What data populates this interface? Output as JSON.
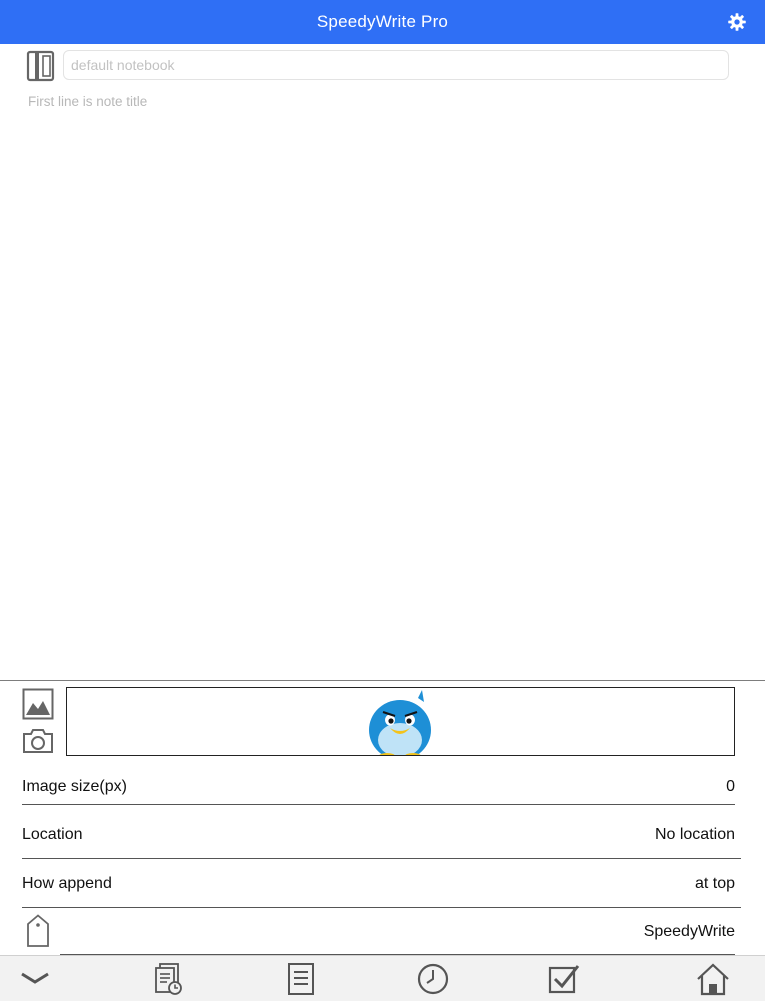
{
  "app": {
    "title": "SpeedyWrite Pro",
    "accent_color": "#2f6ff5"
  },
  "header": {
    "settings_icon": "gear-icon"
  },
  "notebook": {
    "icon": "notebook-icon",
    "placeholder": "default notebook",
    "value": ""
  },
  "note": {
    "placeholder": "First line is note title",
    "value": ""
  },
  "attachments": {
    "image_picker_icon": "image-icon",
    "camera_icon": "camera-icon",
    "preview": "penguin mascot"
  },
  "settings_rows": [
    {
      "label": "Image size(px)",
      "value": "0"
    },
    {
      "label": "Location",
      "value": "No location"
    },
    {
      "label": "How append",
      "value": "at top"
    },
    {
      "label": "",
      "value": "SpeedyWrite",
      "icon": "tag-icon"
    }
  ],
  "toolbar": {
    "items": [
      "chevron-down-icon",
      "history-icon",
      "document-icon",
      "clock-icon",
      "checkbox-icon",
      "home-icon"
    ]
  }
}
